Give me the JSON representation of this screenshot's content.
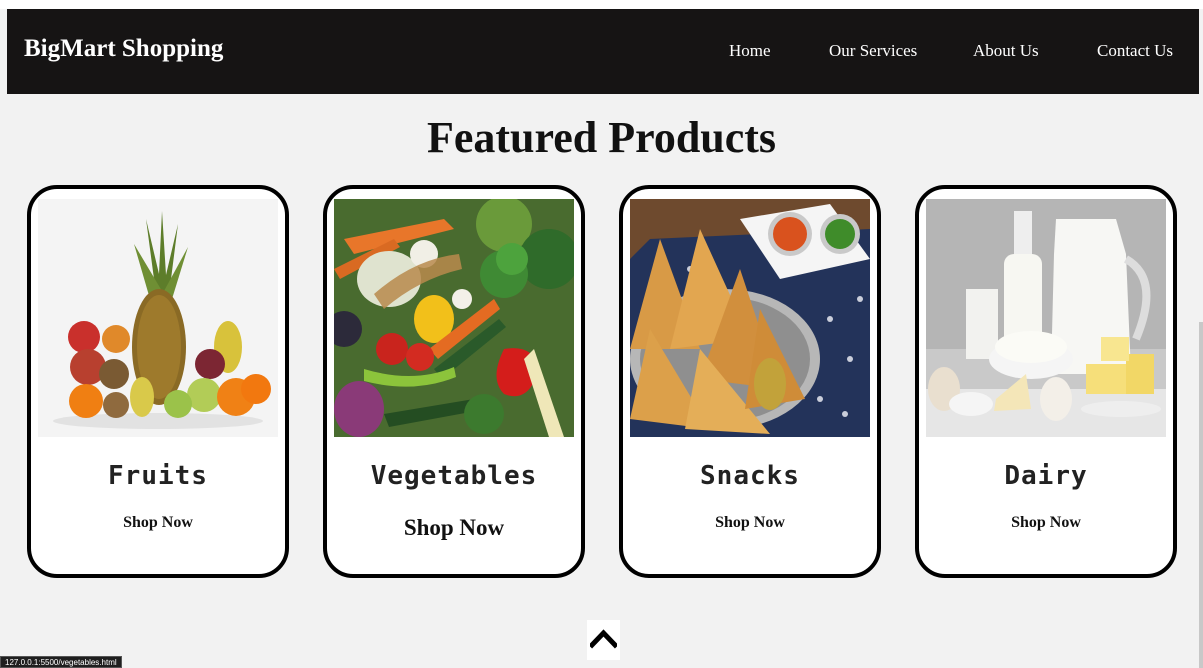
{
  "brand": "BigMart Shopping",
  "nav": {
    "home": "Home",
    "services": "Our Services",
    "about": "About Us",
    "contact": "Contact Us"
  },
  "page_title": "Featured Products",
  "products": [
    {
      "name": "Fruits",
      "cta": "Shop Now"
    },
    {
      "name": "Vegetables",
      "cta": "Shop Now"
    },
    {
      "name": "Snacks",
      "cta": "Shop Now"
    },
    {
      "name": "Dairy",
      "cta": "Shop Now"
    }
  ],
  "status_url": "127.0.0.1:5500/vegetables.html",
  "icons": {
    "back_to_top": "chevron-up-icon"
  },
  "colors": {
    "navbar": "#161414",
    "page_bg": "#f2f2f2",
    "card_border": "#000000"
  }
}
